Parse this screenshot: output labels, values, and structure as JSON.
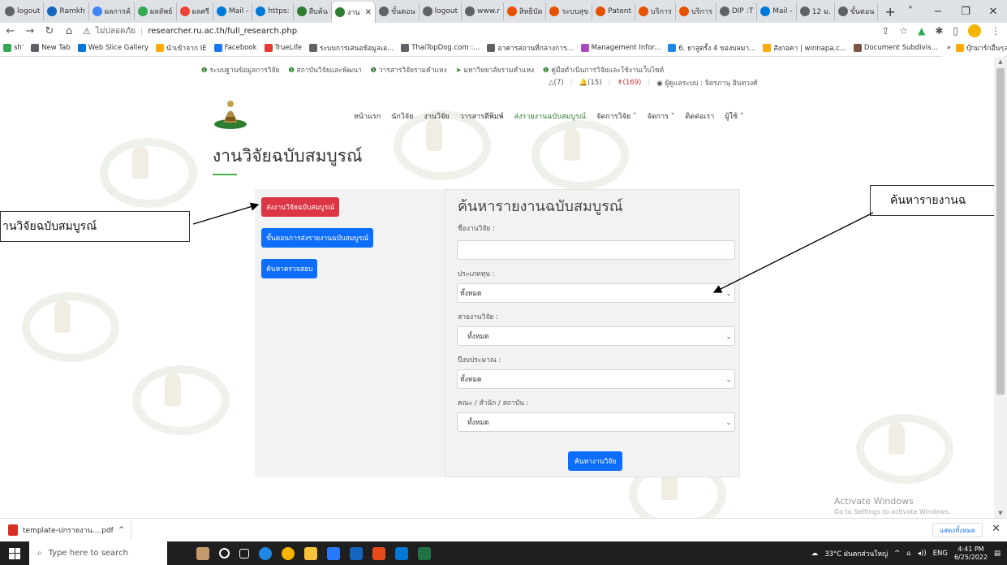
{
  "browser": {
    "tabs": [
      {
        "label": "logout",
        "color": "#5f6368"
      },
      {
        "label": "Ramkh",
        "color": "#1565c0"
      },
      {
        "label": "ผลการค้",
        "color": "#4285f4"
      },
      {
        "label": "ผลลัพธ์",
        "color": "#34a853"
      },
      {
        "label": "ผลศรี",
        "color": "#ea4335"
      },
      {
        "label": "Mail -",
        "color": "#0078d4"
      },
      {
        "label": "https:",
        "color": "#0078d4"
      },
      {
        "label": "สืบค้น",
        "color": "#2e7d32"
      },
      {
        "label": "งาน",
        "color": "#2e7d32",
        "active": true
      },
      {
        "label": "ขั้นตอน",
        "color": "#5f6368"
      },
      {
        "label": "logout",
        "color": "#5f6368"
      },
      {
        "label": "www.r",
        "color": "#5f6368"
      },
      {
        "label": "สิทธิบัต",
        "color": "#e65100"
      },
      {
        "label": "ระบบสุข",
        "color": "#e65100"
      },
      {
        "label": "Patent",
        "color": "#e65100"
      },
      {
        "label": "บริการ",
        "color": "#e65100"
      },
      {
        "label": "บริการ",
        "color": "#e65100"
      },
      {
        "label": "DIP :T",
        "color": "#5f6368"
      },
      {
        "label": "Mail -",
        "color": "#0078d4"
      },
      {
        "label": "12 ม.",
        "color": "#5f6368"
      },
      {
        "label": "ขั้นตอน",
        "color": "#5f6368"
      }
    ],
    "new_tab": "+",
    "window_controls": [
      "˅",
      "−",
      "❐",
      "✕"
    ],
    "address": {
      "warning_icon": "⚠",
      "insecure_text": "ไม่ปลอดภัย",
      "url": "researcher.ru.ac.th/full_research.php"
    },
    "bookmarks": [
      {
        "label": "sh'",
        "color": "#34a853"
      },
      {
        "label": "New Tab",
        "color": "#5f6368"
      },
      {
        "label": "Web Slice Gallery",
        "color": "#0078d4"
      },
      {
        "label": "นำเข้าจาก IE",
        "color": "#f9ab00"
      },
      {
        "label": "Facebook",
        "color": "#1877f2"
      },
      {
        "label": "TrueLife",
        "color": "#e53935"
      },
      {
        "label": "ระบบการเสนอข้อมูลเอ...",
        "color": "#5f6368"
      },
      {
        "label": "ThaiTopDog.com :...",
        "color": "#5f6368"
      },
      {
        "label": "อาคารสถานที่กลางการ...",
        "color": "#5f6368"
      },
      {
        "label": "Management Infor...",
        "color": "#ab47bc"
      },
      {
        "label": "6. ยาสูตรั้ง 4 ของบลมา...",
        "color": "#1e88e5"
      },
      {
        "label": "สังกอคา | winnapa.c...",
        "color": "#f9ab00"
      },
      {
        "label": "Document Subdivis...",
        "color": "#795548"
      },
      {
        "label": "ค้นคุณการผลิตผลสมมตะ...",
        "color": "#1e88e5"
      }
    ],
    "bookmarks_more": "»",
    "bookmarks_folder": "บุ๊กมาร์กอื่นๆ"
  },
  "page": {
    "top_links": [
      "ระบบฐานข้อมูลการวิจัย",
      "สถาบันวิจัยและพัฒนา",
      "วารสารวิจัยรามคำแหง",
      "มหาวิทยาลัยรามคำแหง",
      "คู่มือดำเนินการวิจัยและใช้งานเว็บไซต์"
    ],
    "status": {
      "chat": "(7)",
      "bell": "(15)",
      "pin": "(169)",
      "user": "ผู้ดูแลระบบ : จิตรภานุ อินทวงศ์"
    },
    "nav": [
      "หน้าแรก",
      "นักวิจัย",
      "งานวิจัย",
      "วารสารตีพิมพ์",
      "ส่งรายงานฉบับสมบูรณ์",
      "จัดการวิจัย ˅",
      "จัดการ ˅",
      "ติดต่อเรา",
      "ผู้ใช้ ˅"
    ],
    "title": "งานวิจัยฉบับสมบูรณ์",
    "buttons": {
      "submit": "ส่งงานวิจัยฉบับสมบูรณ์",
      "steps": "ขั้นตอนการส่งรายงานฉบับสมบูรณ์",
      "verify": "ค้นหาตรวจสอบ"
    },
    "search": {
      "title": "ค้นหารายงานฉบับสมบูรณ์",
      "name_label": "ชื่องานวิจัย :",
      "name_value": "",
      "type_label": "ประเภททุน :",
      "type_value": "ทั้งหมด",
      "line_label": "สายงานวิจัย :",
      "line_value": "ทั้งหมด",
      "year_label": "ปีงบประมาณ :",
      "year_value": "ทั้งหมด",
      "faculty_label": "คณะ / สำนัก / สถาบัน :",
      "faculty_value": "ทั้งหมด",
      "button": "ค้นหางานวิจัย"
    },
    "callouts": {
      "left": "านวิจัยฉบับสมบูรณ์",
      "right": "ค้นหารายงานฉ"
    },
    "activate_title": "Activate Windows",
    "activate_sub": "Go to Settings to activate Windows."
  },
  "downloads": {
    "file": "template-ปกรายงาน....pdf",
    "chevron": "^",
    "show_all": "แสดงทั้งหมด",
    "close": "✕"
  },
  "taskbar": {
    "search_placeholder": "Type here to search",
    "weather": "33°C ฝนตกส่วนใหญ่",
    "lang": "ENG",
    "time": "4:41 PM",
    "date": "6/25/2022"
  }
}
